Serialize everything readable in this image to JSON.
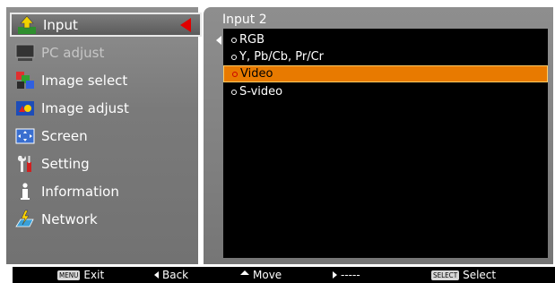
{
  "left_menu": {
    "items": [
      {
        "label": "Input",
        "icon": "input-icon",
        "selected": true
      },
      {
        "label": "PC adjust",
        "icon": "pc-adjust-icon",
        "dim": true
      },
      {
        "label": "Image select",
        "icon": "image-select-icon"
      },
      {
        "label": "Image adjust",
        "icon": "image-adjust-icon"
      },
      {
        "label": "Screen",
        "icon": "screen-icon"
      },
      {
        "label": "Setting",
        "icon": "setting-icon"
      },
      {
        "label": "Information",
        "icon": "information-icon"
      },
      {
        "label": "Network",
        "icon": "network-icon"
      }
    ]
  },
  "panel": {
    "title": "Input 2",
    "options": [
      {
        "label": "RGB"
      },
      {
        "label": "Y, Pb/Cb, Pr/Cr"
      },
      {
        "label": "Video",
        "selected": true
      },
      {
        "label": "S-video"
      }
    ]
  },
  "bottom_bar": {
    "exit_key": "MENU",
    "exit_label": "Exit",
    "back_label": "Back",
    "move_label": "Move",
    "next_label": "-----",
    "select_key": "SELECT",
    "select_label": "Select"
  },
  "colors": {
    "highlight": "#e87a00",
    "selector_arrow": "#e00000"
  }
}
